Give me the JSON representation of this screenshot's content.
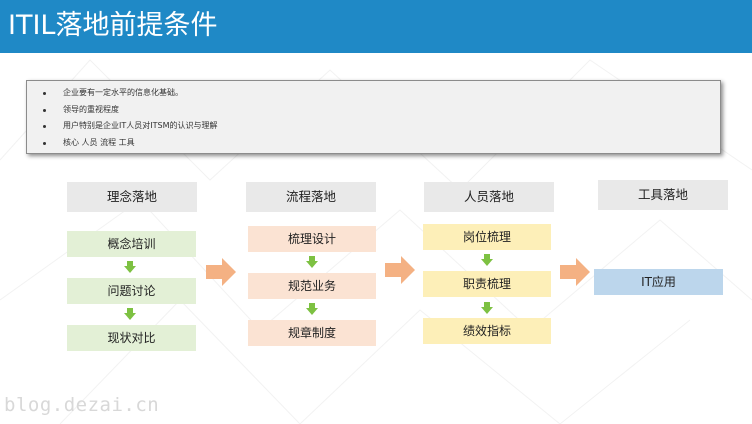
{
  "header": {
    "title": "ITIL落地前提条件"
  },
  "bullets": [
    "企业要有一定水平的信息化基础。",
    "领导的重视程度",
    "用户特别是企业IT人员对ITSM的认识与理解",
    "核心 人员 流程 工具"
  ],
  "columns": [
    {
      "heading": "理念落地",
      "items": [
        "概念培训",
        "问题讨论",
        "现状对比"
      ]
    },
    {
      "heading": "流程落地",
      "items": [
        "梳理设计",
        "规范业务",
        "规章制度"
      ]
    },
    {
      "heading": "人员落地",
      "items": [
        "岗位梳理",
        "职责梳理",
        "绩效指标"
      ]
    },
    {
      "heading": "工具落地",
      "items": [
        "IT应用"
      ]
    }
  ],
  "watermark": "blog.dezai.cn",
  "colors": {
    "header": "#1f89c6",
    "column_1_box": "#e3f0d6",
    "column_2_box": "#fbe3d3",
    "column_3_box": "#fdefb8",
    "column_4_box": "#bcd6ec",
    "down_arrow": "#7dc142",
    "right_arrow": "#f4b183"
  }
}
